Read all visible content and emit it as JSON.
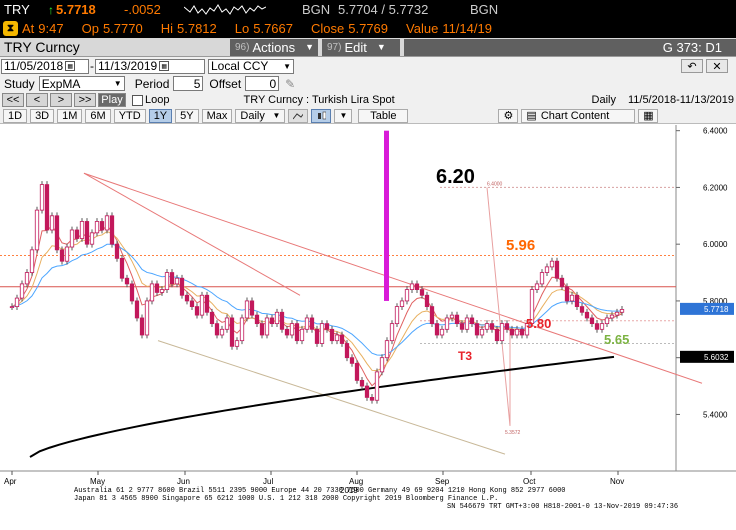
{
  "quote": {
    "symbol": "TRY",
    "arrow": "↑",
    "last": "5.7718",
    "change": "-.0052",
    "source": "BGN",
    "bid_ask": "5.7704 / 5.7732",
    "source2": "BGN"
  },
  "stats": {
    "at_label": "At",
    "at_value": "9:47",
    "open_label": "Op",
    "open_value": "5.7770",
    "high_label": "Hi",
    "high_value": "5.7812",
    "low_label": "Lo",
    "low_value": "5.7667",
    "close_label": "Close",
    "close_value": "5.7769",
    "value_label": "Value",
    "value_date": "11/14/19"
  },
  "title": {
    "security": "TRY Curncy",
    "actions_num": "96)",
    "actions_label": "Actions",
    "edit_num": "97)",
    "edit_label": "Edit",
    "code": "G 373: D1"
  },
  "daterow": {
    "start": "11/05/2018",
    "end": "11/13/2019",
    "currency": "Local CCY",
    "undo": "↶",
    "close": "✕"
  },
  "studyrow": {
    "study_label": "Study",
    "study_value": "ExpMA",
    "period_label": "Period",
    "period_value": "5",
    "offset_label": "Offset",
    "offset_value": "0"
  },
  "navrow": {
    "first": "<<",
    "prev": "<",
    "next": ">",
    "last": ">>",
    "play": "Play",
    "loop": "Loop",
    "subtitle": "TRY  Curncy : Turkish Lira Spot",
    "frequency": "Daily",
    "range": "11/5/2018-11/13/2019"
  },
  "toolrow": {
    "periods": [
      "1D",
      "3D",
      "1M",
      "6M",
      "YTD",
      "1Y",
      "5Y",
      "Max"
    ],
    "selected_period": "1Y",
    "interval": "Daily",
    "table": "Table",
    "chart_content": "Chart Content"
  },
  "chart_data": {
    "type": "candlestick",
    "x_labels": [
      "Apr",
      "May",
      "Jun",
      "Jul",
      "Aug",
      "Sep",
      "Oct",
      "Nov"
    ],
    "x_year_label": "2019",
    "y_ticks": [
      "6.4000",
      "6.2000",
      "6.0000",
      "5.8000",
      "5.6000",
      "5.4000"
    ],
    "ylim": [
      5.25,
      6.42
    ],
    "last_price_label": "5.7718",
    "ma_label": "5.6032",
    "annotations": [
      {
        "text": "6.20",
        "value": 6.2,
        "color": "#000000"
      },
      {
        "text": "5.96",
        "value": 5.96,
        "color": "#ff6600"
      },
      {
        "text": "5.80",
        "value": 5.8,
        "color": "#e8222a"
      },
      {
        "text": "5.65",
        "value": 5.65,
        "color": "#7cb342"
      },
      {
        "text": "T3",
        "value": 5.645,
        "color": "#e8222a"
      }
    ],
    "small_labels": [
      "6.4000",
      "5.3572"
    ],
    "horizontal_line": 5.85,
    "close": [
      5.78,
      5.81,
      5.86,
      5.9,
      5.98,
      6.12,
      6.21,
      6.05,
      6.1,
      5.98,
      5.94,
      5.99,
      6.05,
      6.02,
      6.08,
      6.0,
      6.04,
      6.08,
      6.05,
      6.1,
      6.0,
      5.95,
      5.88,
      5.86,
      5.8,
      5.74,
      5.68,
      5.8,
      5.86,
      5.83,
      5.84,
      5.9,
      5.86,
      5.88,
      5.82,
      5.8,
      5.78,
      5.75,
      5.82,
      5.76,
      5.72,
      5.68,
      5.7,
      5.74,
      5.64,
      5.66,
      5.74,
      5.8,
      5.75,
      5.72,
      5.68,
      5.74,
      5.72,
      5.76,
      5.7,
      5.68,
      5.72,
      5.66,
      5.7,
      5.74,
      5.7,
      5.65,
      5.72,
      5.7,
      5.66,
      5.68,
      5.65,
      5.6,
      5.58,
      5.52,
      5.5,
      5.46,
      5.45,
      5.55,
      5.6,
      5.66,
      5.72,
      5.78,
      5.8,
      5.84,
      5.86,
      5.84,
      5.82,
      5.78,
      5.72,
      5.68,
      5.7,
      5.74,
      5.75,
      5.72,
      5.7,
      5.74,
      5.72,
      5.68,
      5.7,
      5.72,
      5.7,
      5.66,
      5.72,
      5.7,
      5.68,
      5.7,
      5.68,
      5.72,
      5.84,
      5.86,
      5.9,
      5.92,
      5.94,
      5.88,
      5.85,
      5.8,
      5.82,
      5.78,
      5.76,
      5.74,
      5.72,
      5.7,
      5.72,
      5.74,
      5.75,
      5.76,
      5.77
    ]
  },
  "footer": {
    "line1": "Australia 61 2 9777 8600  Brazil 5511 2395 9000  Europe 44 20 7330 7500  Germany 49 69 9204 1210  Hong Kong 852 2977 6000",
    "line2": "Japan 81 3 4565 8900        Singapore 65 6212 1000        U.S. 1 212 318 2000          Copyright 2019 Bloomberg Finance L.P.",
    "line3": "SN 546679 TRT  GMT+3:00 H818-2001-0 13-Nov-2019 09:47:36"
  }
}
